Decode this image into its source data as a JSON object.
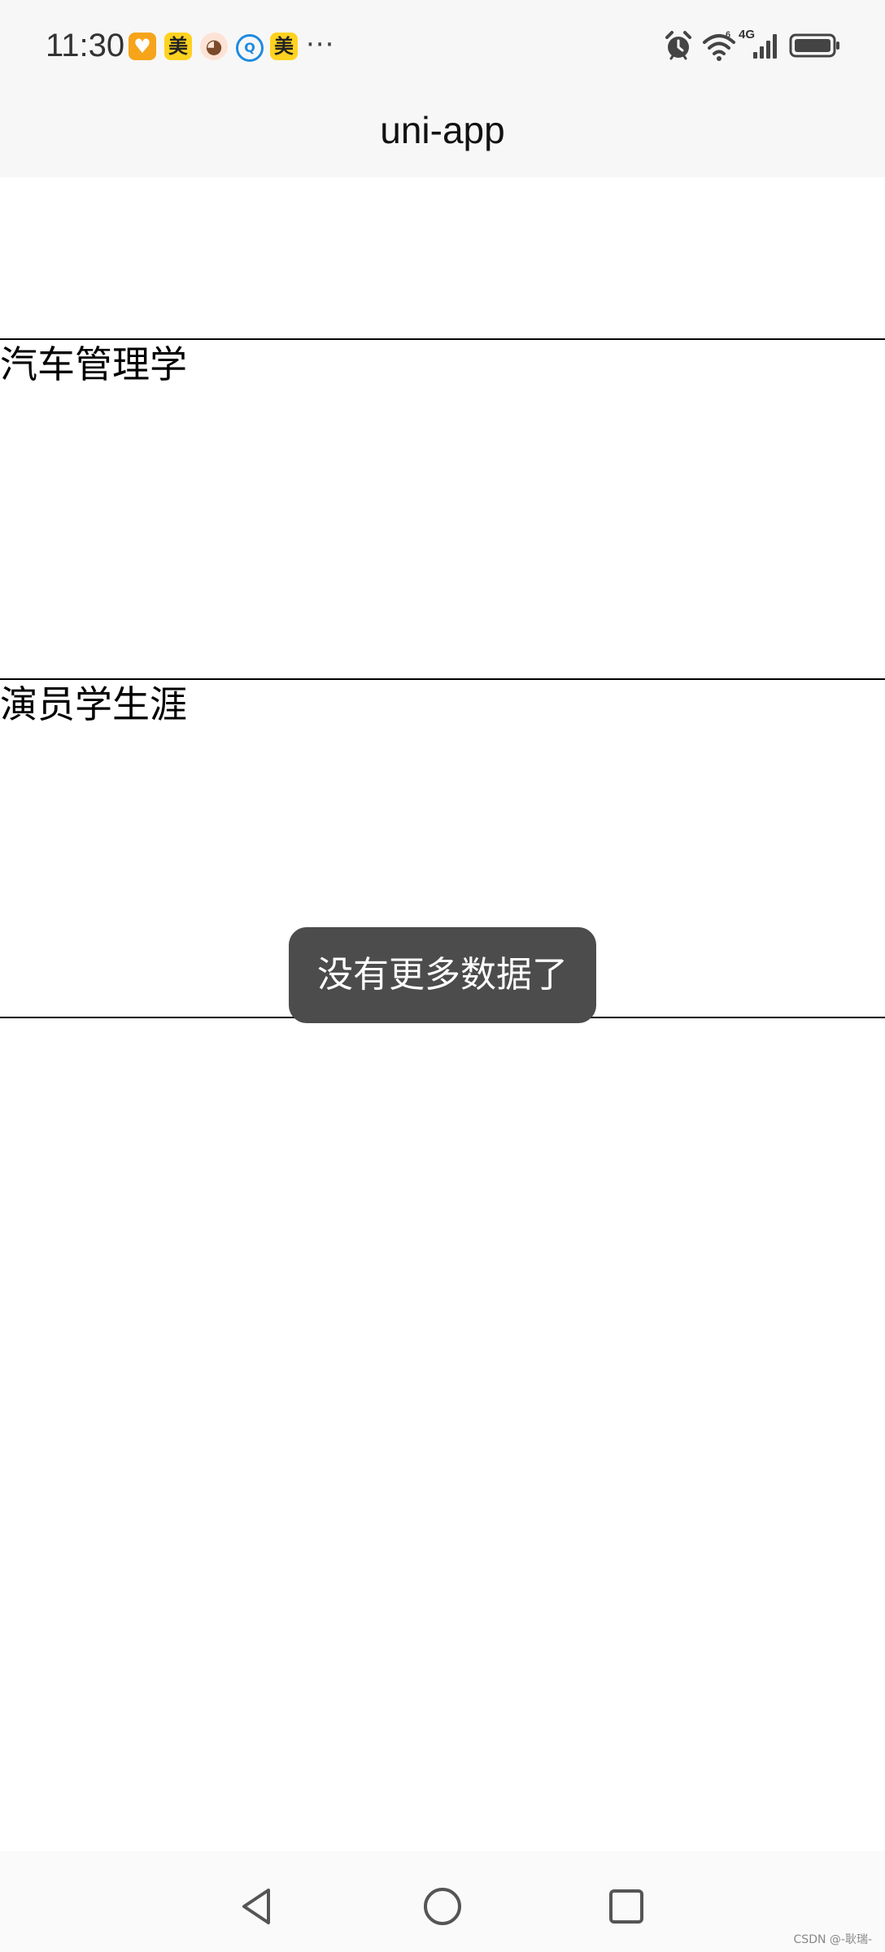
{
  "status_bar": {
    "time": "11:30",
    "notification_icons": [
      {
        "name": "heart-app-icon",
        "glyph": "♥"
      },
      {
        "name": "meituan-icon",
        "glyph": "美"
      },
      {
        "name": "avatar-app-icon",
        "glyph": "◕"
      },
      {
        "name": "chat-bubble-icon",
        "glyph": "Q"
      },
      {
        "name": "meituan-icon",
        "glyph": "美"
      }
    ],
    "more": "···",
    "network_label": "4G",
    "wifi_label": "6"
  },
  "nav_bar": {
    "title": "uni-app"
  },
  "list": {
    "items": [
      {
        "label": "汽车管理学"
      },
      {
        "label": "演员学生涯"
      }
    ]
  },
  "toast": {
    "message": "没有更多数据了"
  },
  "watermark": "CSDN @-耿瑞-"
}
